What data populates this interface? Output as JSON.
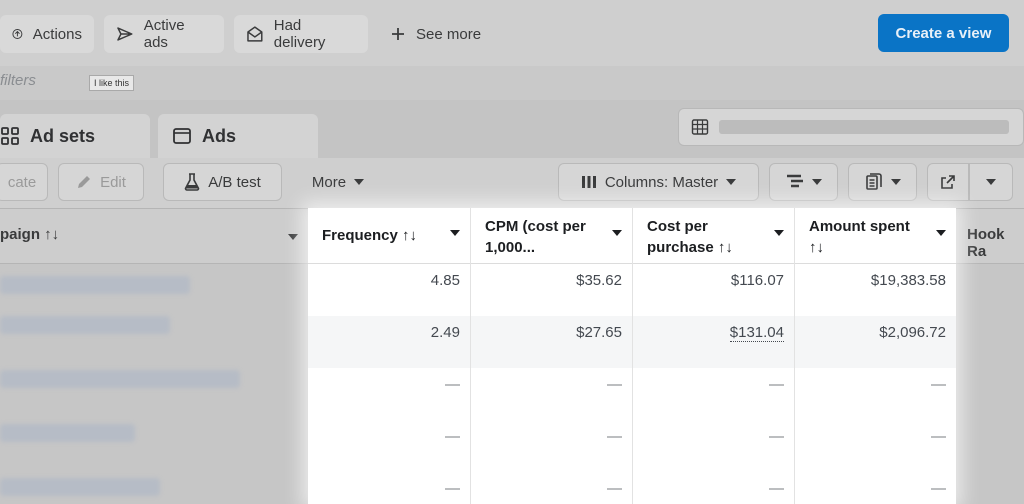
{
  "filter_bar": {
    "chips": [
      {
        "label": "Actions",
        "icon": "arrow-circle-up-icon"
      },
      {
        "label": "Active ads",
        "icon": "paper-plane-icon"
      },
      {
        "label": "Had delivery",
        "icon": "envelope-open-icon"
      }
    ],
    "see_more_label": "See more",
    "create_view_label": "Create a view",
    "filters_label": "filters",
    "tooltip": "I like this"
  },
  "tabs": [
    {
      "label": "Ad sets",
      "icon": "grid-icon"
    },
    {
      "label": "Ads",
      "icon": "window-icon"
    }
  ],
  "toolbar": {
    "duplicate_label": "cate",
    "edit_label": "Edit",
    "ab_test_label": "A/B test",
    "more_label": "More",
    "columns_label": "Columns: Master"
  },
  "table": {
    "campaign_header": "paign ↑↓",
    "hook_header": "Hook Ra",
    "columns": [
      {
        "key": "frequency",
        "line1": "Frequency ↑↓",
        "line2": ""
      },
      {
        "key": "cpm",
        "line1": "CPM (cost per",
        "line2": "1,000..."
      },
      {
        "key": "cost_per_purchase",
        "line1": "Cost per",
        "line2": "purchase ↑↓"
      },
      {
        "key": "amount_spent",
        "line1": "Amount spent",
        "line2": "↑↓"
      }
    ],
    "rows": [
      [
        "4.85",
        "$35.62",
        "$116.07",
        "$19,383.58"
      ],
      [
        "2.49",
        "$27.65",
        "$131.04",
        "$2,096.72"
      ],
      [
        "—",
        "—",
        "—",
        "—"
      ],
      [
        "—",
        "—",
        "—",
        "—"
      ],
      [
        "—",
        "—",
        "—",
        "—"
      ]
    ]
  }
}
